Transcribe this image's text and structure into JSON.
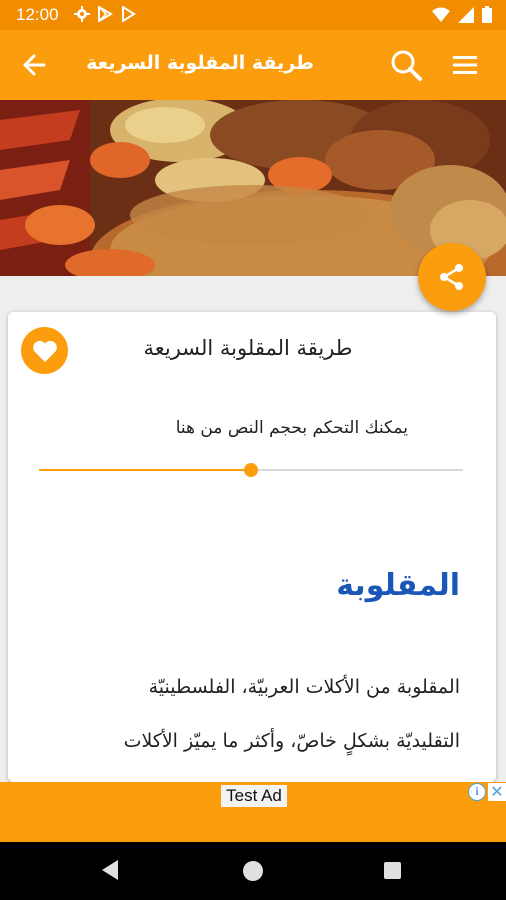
{
  "status_bar": {
    "time": "12:00",
    "left_icons": [
      "gear-icon",
      "play-store-icon",
      "play-icon"
    ],
    "right_icons": [
      "wifi-icon",
      "signal-icon",
      "battery-icon"
    ]
  },
  "appbar": {
    "title": "طريقة المقلوبة السريعة",
    "back_icon": "arrow-back-icon",
    "search_icon": "search-icon",
    "menu_icon": "menu-icon",
    "color": "#fb9d0c"
  },
  "hero": {
    "image": "maqluba-dish-photo",
    "share_icon": "share-icon"
  },
  "card": {
    "favorite_icon": "heart-icon",
    "title": "طريقة المقلوبة السريعة",
    "font_hint": "يمكنك التحكم بحجم النص من هنا",
    "font_size_slider": {
      "value": 0.5
    },
    "section_heading": "المقلوبة",
    "paragraphs": [
      "المقلوبة من الأكلات العربيّة، الفلسطينيّة",
      "التقليديّة بشكلٍ خاصّ، وأكثر ما يميّز الأكلات"
    ]
  },
  "ad": {
    "label": "Test Ad",
    "info_icon": "info-icon",
    "close_icon": "close-icon"
  },
  "nav_bar": {
    "icons": [
      "nav-back-icon",
      "nav-home-icon",
      "nav-recents-icon"
    ]
  },
  "colors": {
    "status_bar": "#f28c00",
    "accent": "#fb9d0c",
    "heading": "#1b57b8"
  }
}
